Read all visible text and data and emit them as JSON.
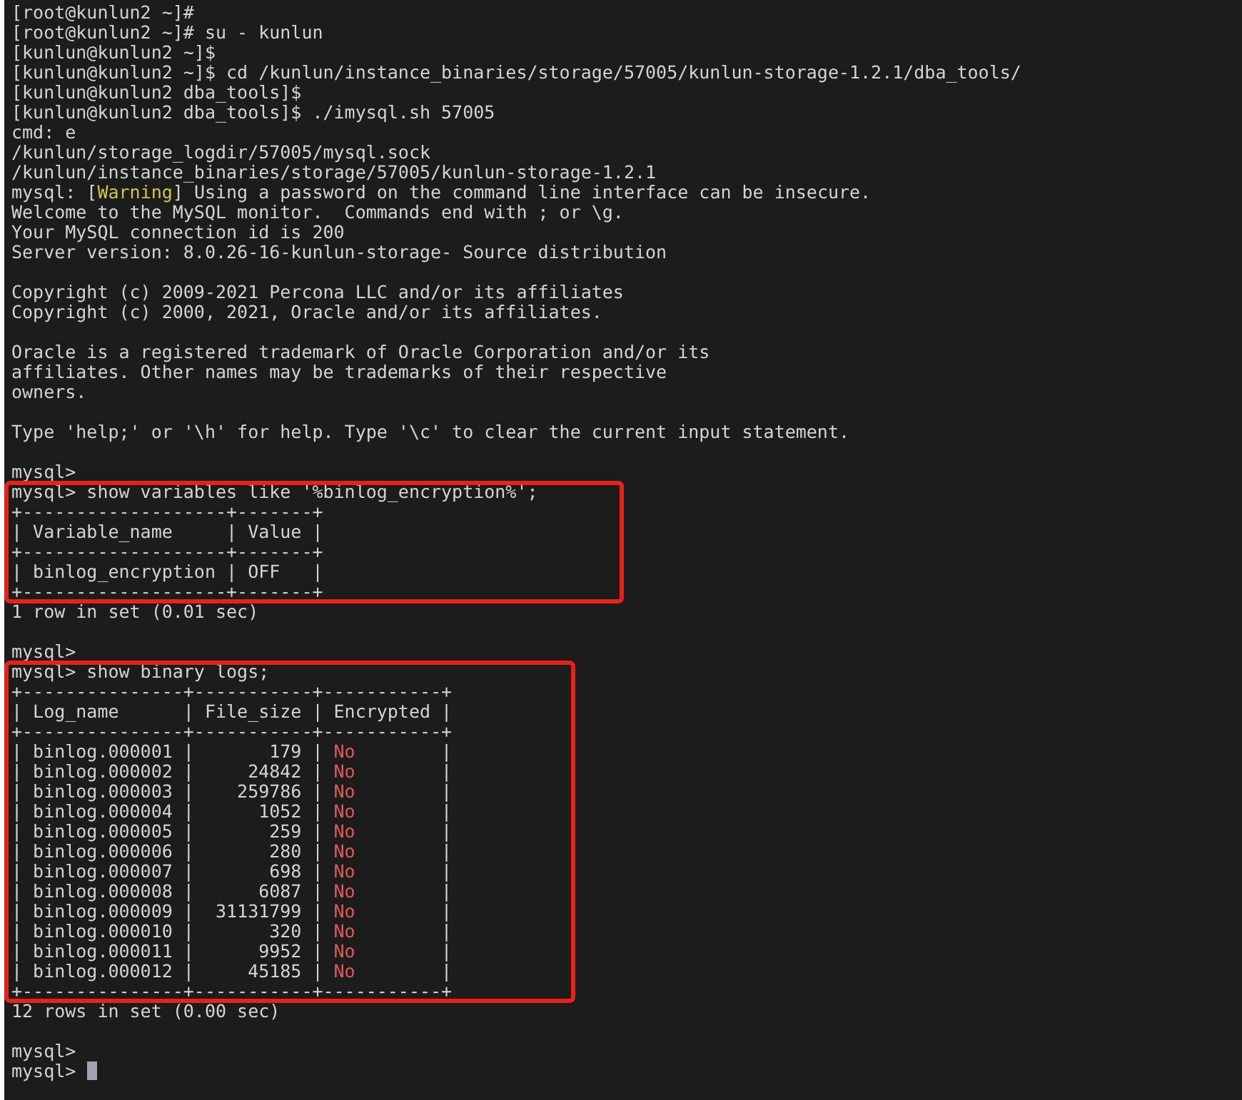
{
  "terminal": {
    "blocks": [
      {
        "blank_before": false,
        "boxed": false,
        "lines": [
          [
            {
              "text": "[root@kunlun2 ~]#"
            }
          ],
          [
            {
              "text": "[root@kunlun2 ~]# su - kunlun"
            }
          ],
          [
            {
              "text": "[kunlun@kunlun2 ~]$"
            }
          ],
          [
            {
              "text": "[kunlun@kunlun2 ~]$ cd /kunlun/instance_binaries/storage/57005/kunlun-storage-1.2.1/dba_tools/"
            }
          ],
          [
            {
              "text": "[kunlun@kunlun2 dba_tools]$"
            }
          ],
          [
            {
              "text": "[kunlun@kunlun2 dba_tools]$ ./imysql.sh 57005"
            }
          ],
          [
            {
              "text": "cmd: e"
            }
          ],
          [
            {
              "text": "/kunlun/storage_logdir/57005/mysql.sock"
            }
          ],
          [
            {
              "text": "/kunlun/instance_binaries/storage/57005/kunlun-storage-1.2.1"
            }
          ],
          [
            {
              "text": "mysql: ["
            },
            {
              "text": "Warning",
              "color": "#c9c94c"
            },
            {
              "text": "] Using a password on the command line interface can be insecure."
            }
          ],
          [
            {
              "text": "Welcome to the MySQL monitor.  Commands end with ; or \\g."
            }
          ],
          [
            {
              "text": "Your MySQL connection id is 200"
            }
          ],
          [
            {
              "text": "Server version: 8.0.26-16-kunlun-storage- Source distribution"
            }
          ]
        ]
      },
      {
        "blank_before": true,
        "boxed": false,
        "lines": [
          [
            {
              "text": "Copyright (c) 2009-2021 Percona LLC and/or its affiliates"
            }
          ],
          [
            {
              "text": "Copyright (c) 2000, 2021, Oracle and/or its affiliates."
            }
          ]
        ]
      },
      {
        "blank_before": true,
        "boxed": false,
        "lines": [
          [
            {
              "text": "Oracle is a registered trademark of Oracle Corporation and/or its"
            }
          ],
          [
            {
              "text": "affiliates. Other names may be trademarks of their respective"
            }
          ],
          [
            {
              "text": "owners."
            }
          ]
        ]
      },
      {
        "blank_before": true,
        "boxed": false,
        "lines": [
          [
            {
              "text": "Type 'help;' or '\\h' for help. Type '\\c' to clear the current input statement."
            }
          ]
        ]
      },
      {
        "blank_before": true,
        "boxed": false,
        "lines": [
          [
            {
              "text": "mysql>"
            }
          ]
        ]
      },
      {
        "blank_before": false,
        "boxed": true,
        "lines": [
          [
            {
              "text": "mysql> show variables like '%binlog_encryption%';"
            }
          ],
          [
            {
              "text": "+-------------------+-------+"
            }
          ],
          [
            {
              "text": "| Variable_name     | Value |"
            }
          ],
          [
            {
              "text": "+-------------------+-------+"
            }
          ],
          [
            {
              "text": "| binlog_encryption | OFF   |"
            }
          ],
          [
            {
              "text": "+-------------------+-------+"
            }
          ]
        ]
      },
      {
        "blank_before": false,
        "boxed": false,
        "lines": [
          [
            {
              "text": "1 row in set (0.01 sec)"
            }
          ]
        ]
      },
      {
        "blank_before": true,
        "boxed": false,
        "lines": [
          [
            {
              "text": "mysql>"
            }
          ]
        ]
      },
      {
        "blank_before": false,
        "boxed": true,
        "lines": [
          [
            {
              "text": "mysql> show binary logs;"
            }
          ],
          [
            {
              "text": "+---------------+-----------+-----------+"
            }
          ],
          [
            {
              "text": "| Log_name      | File_size | Encrypted |"
            }
          ],
          [
            {
              "text": "+---------------+-----------+-----------+"
            }
          ],
          [
            {
              "text": "| binlog.000001 |       179 | "
            },
            {
              "text": "No",
              "color": "#e05a5a"
            },
            {
              "text": "        |"
            }
          ],
          [
            {
              "text": "| binlog.000002 |     24842 | "
            },
            {
              "text": "No",
              "color": "#e05a5a"
            },
            {
              "text": "        |"
            }
          ],
          [
            {
              "text": "| binlog.000003 |    259786 | "
            },
            {
              "text": "No",
              "color": "#e05a5a"
            },
            {
              "text": "        |"
            }
          ],
          [
            {
              "text": "| binlog.000004 |      1052 | "
            },
            {
              "text": "No",
              "color": "#e05a5a"
            },
            {
              "text": "        |"
            }
          ],
          [
            {
              "text": "| binlog.000005 |       259 | "
            },
            {
              "text": "No",
              "color": "#e05a5a"
            },
            {
              "text": "        |"
            }
          ],
          [
            {
              "text": "| binlog.000006 |       280 | "
            },
            {
              "text": "No",
              "color": "#e05a5a"
            },
            {
              "text": "        |"
            }
          ],
          [
            {
              "text": "| binlog.000007 |       698 | "
            },
            {
              "text": "No",
              "color": "#e05a5a"
            },
            {
              "text": "        |"
            }
          ],
          [
            {
              "text": "| binlog.000008 |      6087 | "
            },
            {
              "text": "No",
              "color": "#e05a5a"
            },
            {
              "text": "        |"
            }
          ],
          [
            {
              "text": "| binlog.000009 |  31131799 | "
            },
            {
              "text": "No",
              "color": "#e05a5a"
            },
            {
              "text": "        |"
            }
          ],
          [
            {
              "text": "| binlog.000010 |       320 | "
            },
            {
              "text": "No",
              "color": "#e05a5a"
            },
            {
              "text": "        |"
            }
          ],
          [
            {
              "text": "| binlog.000011 |      9952 | "
            },
            {
              "text": "No",
              "color": "#e05a5a"
            },
            {
              "text": "        |"
            }
          ],
          [
            {
              "text": "| binlog.000012 |     45185 | "
            },
            {
              "text": "No",
              "color": "#e05a5a"
            },
            {
              "text": "        |"
            }
          ],
          [
            {
              "text": "+---------------+-----------+-----------+"
            }
          ]
        ]
      },
      {
        "blank_before": false,
        "boxed": false,
        "lines": [
          [
            {
              "text": "12 rows in set (0.00 sec)"
            }
          ]
        ]
      },
      {
        "blank_before": true,
        "boxed": false,
        "lines": [
          [
            {
              "text": "mysql>"
            }
          ],
          [
            {
              "text": "mysql> "
            }
          ]
        ]
      }
    ]
  }
}
